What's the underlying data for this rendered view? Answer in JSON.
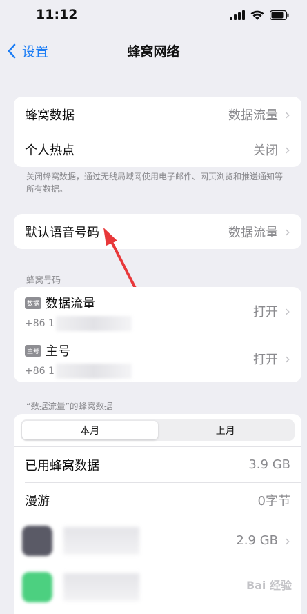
{
  "status": {
    "time": "11:12"
  },
  "nav": {
    "back_label": "设置",
    "title": "蜂窝网络"
  },
  "group1": [
    {
      "label": "蜂窝数据",
      "value": "数据流量"
    },
    {
      "label": "个人热点",
      "value": "关闭"
    }
  ],
  "group1_note": "关闭蜂窝数据，通过无线局域网使用电子邮件、网页浏览和推送通知等所有数据。",
  "default_voice": {
    "label": "默认语音号码",
    "value": "数据流量"
  },
  "sim_section_label": "蜂窝号码",
  "sims": [
    {
      "badge": "数据",
      "name": "数据流量",
      "number": "+86 1",
      "status": "打开"
    },
    {
      "badge": "主号",
      "name": "主号",
      "number": "+86 1",
      "status": "打开"
    }
  ],
  "usage_section_label": "“数据流量”的蜂窝数据",
  "segments": [
    {
      "label": "本月",
      "active": true
    },
    {
      "label": "上月",
      "active": false
    }
  ],
  "usage_rows": [
    {
      "label": "已用蜂窝数据",
      "value": "3.9 GB"
    },
    {
      "label": "漫游",
      "value": "0字节"
    }
  ],
  "apps": [
    {
      "value": "2.9 GB",
      "icon_color": "#5a5a66"
    },
    {
      "value": "",
      "icon_color": "#4cd080"
    }
  ],
  "colors": {
    "accent": "#1a7cf5",
    "annotation_arrow": "#e8383a"
  },
  "watermark": "Bai 经验"
}
